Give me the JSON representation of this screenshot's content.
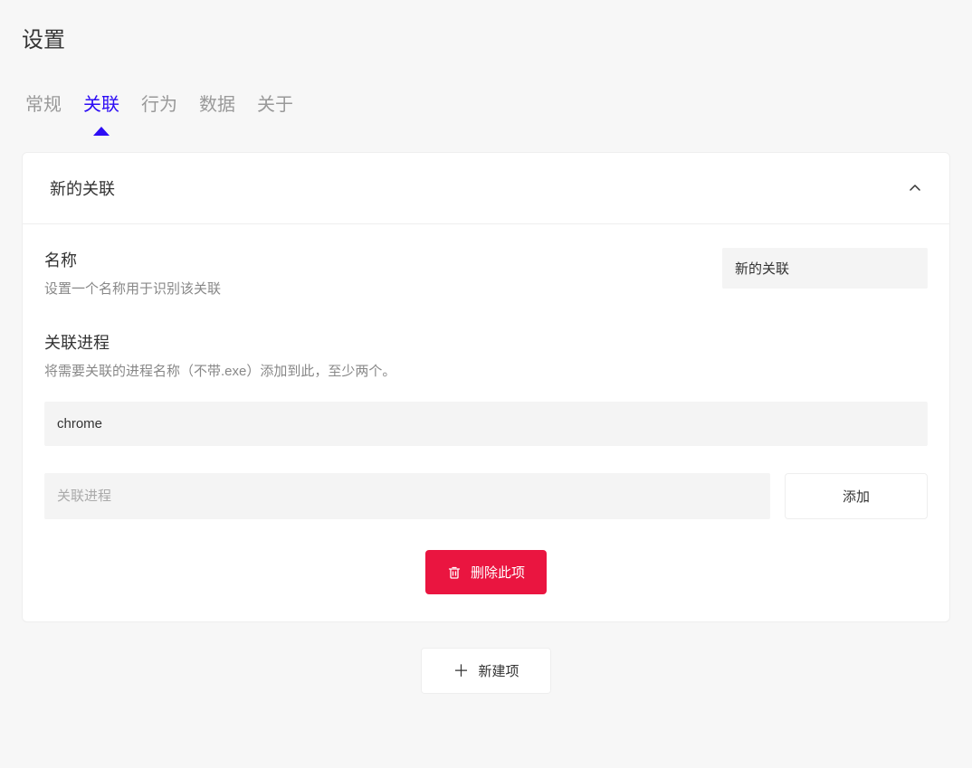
{
  "page_title": "设置",
  "tabs": [
    {
      "label": "常规",
      "active": false
    },
    {
      "label": "关联",
      "active": true
    },
    {
      "label": "行为",
      "active": false
    },
    {
      "label": "数据",
      "active": false
    },
    {
      "label": "关于",
      "active": false
    }
  ],
  "panel": {
    "header_title": "新的关联",
    "name_field": {
      "label": "名称",
      "desc": "设置一个名称用于识别该关联",
      "value": "新的关联"
    },
    "process_field": {
      "label": "关联进程",
      "desc": "将需要关联的进程名称（不带.exe）添加到此，至少两个。",
      "items": [
        "chrome"
      ],
      "add_placeholder": "关联进程",
      "add_button": "添加"
    },
    "delete_button": "删除此项"
  },
  "new_item_button": "新建项"
}
